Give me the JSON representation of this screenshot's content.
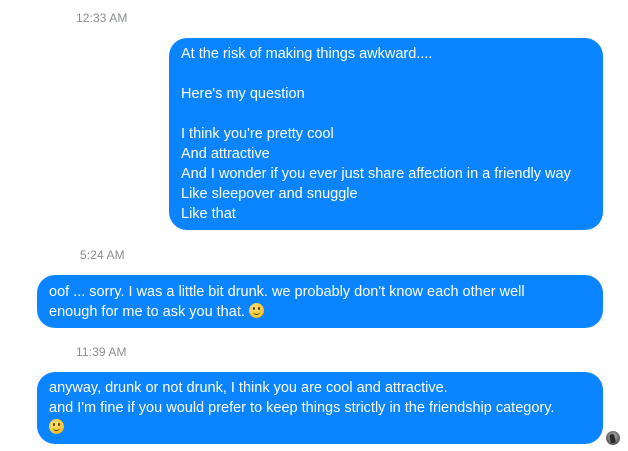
{
  "conversation": {
    "timestamps": [
      "12:33 AM",
      "5:24 AM",
      "11:39 AM"
    ],
    "messages": [
      {
        "direction": "outgoing",
        "lines": [
          "At the risk of making things awkward....",
          "",
          "Here's my question",
          "",
          "I think you're pretty cool",
          "And attractive",
          "And I wonder if you ever just share affection in a friendly way",
          "Like sleepover and snuggle",
          "Like that"
        ]
      },
      {
        "direction": "incoming",
        "lines": [
          "oof ... sorry. I was a little bit drunk. we probably don't know each other well",
          "enough for me to ask you that."
        ],
        "emoji": "smiling-face-emoji"
      },
      {
        "direction": "incoming",
        "lines": [
          "anyway, drunk or not drunk, I think you are cool and attractive.",
          "and I'm fine if you would prefer to keep things strictly in the friendship category."
        ],
        "emoji": "smiling-face-emoji"
      }
    ]
  },
  "avatar": {
    "icon": "contact-avatar"
  },
  "colors": {
    "bubble": "#0a84ff",
    "bubble_text": "#ffffff",
    "timestamp_text": "#8a8d91",
    "background": "#ffffff"
  }
}
